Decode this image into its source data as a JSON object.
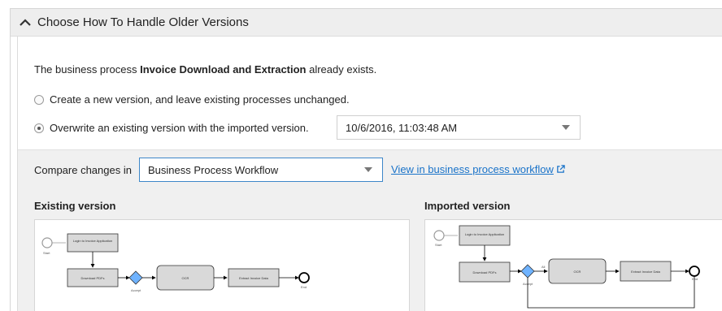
{
  "section": {
    "title": "Choose How To Handle Older Versions"
  },
  "intro": {
    "prefix": "The business process ",
    "process_name": "Invoice Download and Extraction",
    "suffix": " already exists."
  },
  "options": {
    "create_label": "Create a new version, and leave existing processes unchanged.",
    "create_checked": false,
    "overwrite_label": "Overwrite an existing version with the imported version.",
    "overwrite_checked": true,
    "version_select_value": "10/6/2016, 11:03:48 AM"
  },
  "compare": {
    "label": "Compare changes in",
    "select_value": "Business Process Workflow",
    "link_text": "View in business process workflow"
  },
  "existing": {
    "title": "Existing version",
    "nodes": {
      "start": "Start",
      "login": "Login to Invoice Application",
      "download": "Download PDFs",
      "accept": "Accept",
      "ocr": "OCR",
      "extract": "Extract Invoice Data",
      "end": "End"
    }
  },
  "imported": {
    "title": "Imported version",
    "nodes": {
      "start": "Start",
      "login": "Login to Invoice Application",
      "download": "Download PDFs",
      "accept": "Accept",
      "all": "All",
      "ocr": "OCR",
      "extract": "Extract Invoice Data",
      "end": "End"
    }
  }
}
